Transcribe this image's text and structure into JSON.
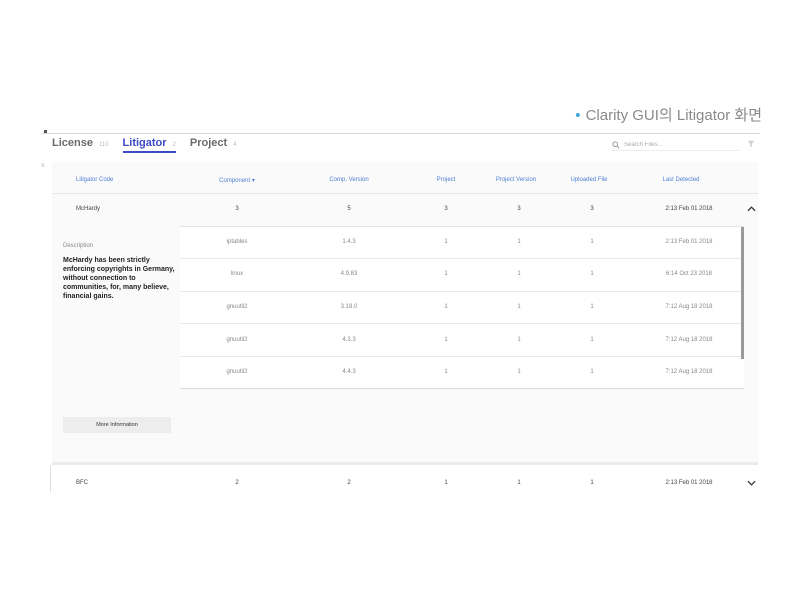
{
  "slide": {
    "bullet": "•",
    "title": "Clarity GUI의 Litigator 화면"
  },
  "tabs": [
    {
      "label": "License",
      "count": "110"
    },
    {
      "label": "Litigator",
      "count": "2"
    },
    {
      "label": "Project",
      "count": "4"
    }
  ],
  "search": {
    "placeholder": "Search Files..."
  },
  "icons": {
    "search": "search-icon",
    "filter": "filter-icon",
    "expand": "chevron-down-icon",
    "collapse": "chevron-up-icon"
  },
  "colors": {
    "accent": "#3d49c7",
    "header_text": "#4f7fd4",
    "title_bullet": "#38a8d8"
  },
  "table": {
    "headers": [
      "Litigator Code",
      "Component ▾",
      "Comp. Version",
      "Project",
      "Project Version",
      "Uploaded File",
      "Last Detected"
    ],
    "rows": [
      {
        "code": "McHardy",
        "component": "3",
        "comp_version": "5",
        "project": "3",
        "project_version": "3",
        "uploaded_file": "3",
        "last_detected": "2:13 Feb 01 2018"
      },
      {
        "code": "BFC",
        "component": "2",
        "comp_version": "2",
        "project": "1",
        "project_version": "1",
        "uploaded_file": "1",
        "last_detected": "2:13 Feb 01 2018"
      }
    ],
    "detail": {
      "description_label": "Description",
      "description_text": "McHardy has been strictly enforcing copyrights in Germany, without connection to communities, for, many believe, financial gains.",
      "more_button": "More Information",
      "sub_rows": [
        {
          "component": "iptables",
          "comp_version": "1.4.3",
          "project": "1",
          "project_version": "1",
          "uploaded_file": "1",
          "last_detected": "2:13 Feb 01 2018"
        },
        {
          "component": "linux",
          "comp_version": "4.9.83",
          "project": "1",
          "project_version": "1",
          "uploaded_file": "1",
          "last_detected": "6:14 Oct 23 2018"
        },
        {
          "component": "gnuutil2",
          "comp_version": "3.18.0",
          "project": "1",
          "project_version": "1",
          "uploaded_file": "1",
          "last_detected": "7:12 Aug 18 2018"
        },
        {
          "component": "gnuutil2",
          "comp_version": "4.3.3",
          "project": "1",
          "project_version": "1",
          "uploaded_file": "1",
          "last_detected": "7:12 Aug 18 2018"
        },
        {
          "component": "gnuutil2",
          "comp_version": "4.4.3",
          "project": "1",
          "project_version": "1",
          "uploaded_file": "1",
          "last_detected": "7:12 Aug 18 2018"
        }
      ]
    }
  }
}
